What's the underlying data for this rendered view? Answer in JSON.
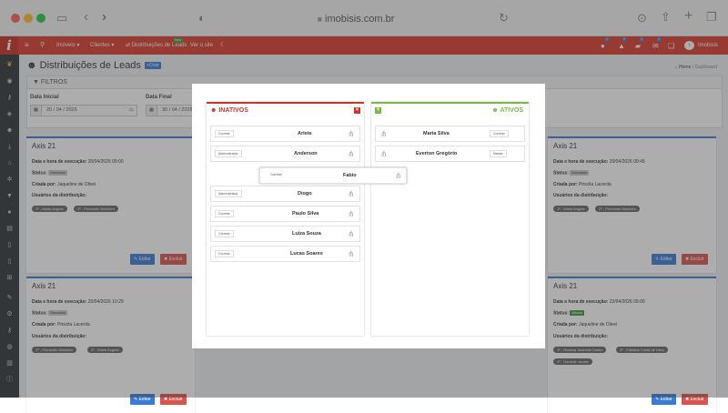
{
  "browser": {
    "url": "imobisis.com.br"
  },
  "topbar": {
    "menu": [
      "Imóveis",
      "Clientes"
    ],
    "distrib": "Distribuições de Leads",
    "new_badge": "New",
    "site": "Ver o site",
    "user": "Imobisis",
    "badges": [
      "1",
      "0",
      "2",
      "1"
    ]
  },
  "page": {
    "title": "Distribuições de Leads",
    "create": "Criar",
    "crumbs": [
      "Home",
      "Dashboard"
    ],
    "filters_title": "FILTROS",
    "start_label": "Data Inicial",
    "start_value": "20 / 04 / 2026",
    "end_label": "Data Final",
    "end_value": "30 / 04 / 2026"
  },
  "labels": {
    "date": "Data e hora de execução:",
    "status": "Status:",
    "created": "Criada por:",
    "users": "Usuários da distribuição:",
    "edit": "Editar",
    "delete": "Excluir"
  },
  "cards": [
    {
      "title": "Axis 21",
      "date": "20/04/2026 09:00",
      "status": "Executada",
      "by": "Jaqueline de Olivei",
      "users": [
        "1º - Maria Angela",
        "2º - Fernando Monteiro"
      ]
    },
    {
      "title": "Axis 21",
      "date": "20/04/2026 09:45",
      "status": "Executada",
      "by": "Priscila Lacerda",
      "users": [
        "1º - Maria Angela",
        "2º - Fernando Monteiro"
      ]
    },
    {
      "title": "Axis 21",
      "date": "20/04/2026 10:29",
      "status": "Executada",
      "by": "Priscila Lacerda",
      "users": [
        "1º - Fernando Monteiro",
        "2º - Maria Angela"
      ]
    },
    {
      "title": "Axis 21",
      "date": "22/04/2026 09:00",
      "status": "Ativada",
      "by": "Jaqueline de Olivei",
      "users": [
        "1º - Rosana Jacinelia Camiz",
        "2º - Fabiane Costa de Lima",
        "3º - Danielle Jordao"
      ]
    }
  ],
  "modal": {
    "inactive_title": "INATIVOS",
    "active_title": "ATIVOS",
    "inactive": [
      {
        "name": "Arlete",
        "role": "Corretor"
      },
      {
        "name": "Anderson",
        "role": "Administrador"
      },
      {
        "name": "Diogo",
        "role": "Administrador"
      },
      {
        "name": "Paulo Silva",
        "role": "Corretor"
      },
      {
        "name": "Luiza Souza",
        "role": "Corretor"
      },
      {
        "name": "Lucas Soares",
        "role": "Corretor"
      }
    ],
    "dragging": {
      "name": "Fabio",
      "role": "Corretor"
    },
    "active": [
      {
        "name": "Maria Silva",
        "role": "Corretor"
      },
      {
        "name": "Everton Gregório",
        "role": "Master"
      }
    ]
  },
  "colors": {
    "brand": "#d9392b",
    "sidebar": "#2e3338",
    "primary": "#3a7bd5",
    "danger": "#d9534f",
    "success": "#3a9b3f",
    "active_green": "#7ab648"
  },
  "icons": [
    "sidebar-icon",
    "back-icon",
    "forward-icon",
    "shield-icon",
    "lock-icon",
    "reload-icon",
    "download-icon",
    "share-icon",
    "plus-icon",
    "tabs-icon",
    "menu-icon",
    "search-icon",
    "users-icon",
    "filter-icon",
    "calendar-icon",
    "drag-handle-icon"
  ]
}
